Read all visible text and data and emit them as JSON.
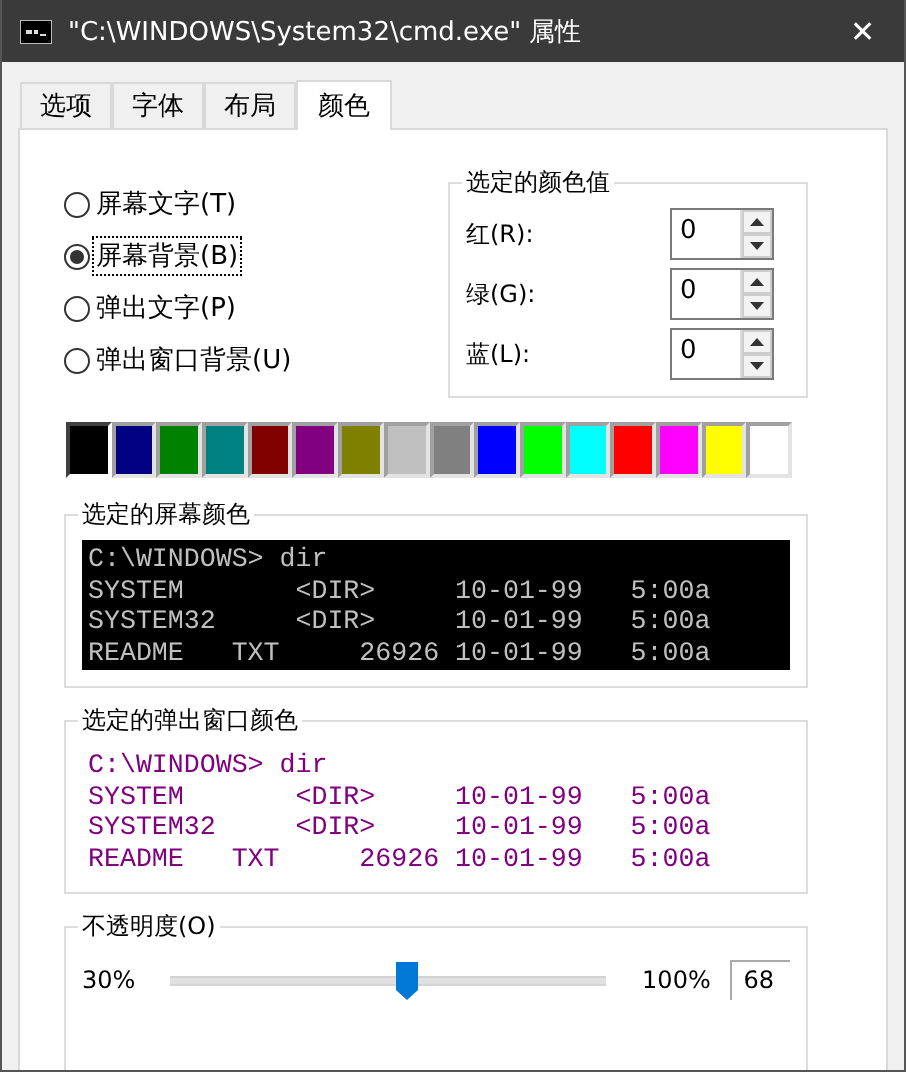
{
  "window": {
    "title": "\"C:\\WINDOWS\\System32\\cmd.exe\" 属性",
    "close": "✕"
  },
  "tabs": [
    {
      "label": "选项",
      "selected": false
    },
    {
      "label": "字体",
      "selected": false
    },
    {
      "label": "布局",
      "selected": false
    },
    {
      "label": "颜色",
      "selected": true
    }
  ],
  "targets": [
    {
      "label": "屏幕文字(T)",
      "selected": false
    },
    {
      "label": "屏幕背景(B)",
      "selected": true
    },
    {
      "label": "弹出文字(P)",
      "selected": false
    },
    {
      "label": "弹出窗口背景(U)",
      "selected": false
    }
  ],
  "color_values": {
    "title": "选定的颜色值",
    "fields": [
      {
        "label": "红(R):",
        "value": "0"
      },
      {
        "label": "绿(G):",
        "value": "0"
      },
      {
        "label": "蓝(L):",
        "value": "0"
      }
    ]
  },
  "palette": [
    {
      "color": "#000000",
      "selected": true
    },
    {
      "color": "#000080",
      "selected": false
    },
    {
      "color": "#008000",
      "selected": false
    },
    {
      "color": "#008080",
      "selected": false
    },
    {
      "color": "#800000",
      "selected": false
    },
    {
      "color": "#800080",
      "selected": false
    },
    {
      "color": "#808000",
      "selected": false
    },
    {
      "color": "#c0c0c0",
      "selected": false
    },
    {
      "color": "#808080",
      "selected": false
    },
    {
      "color": "#0000ff",
      "selected": false
    },
    {
      "color": "#00ff00",
      "selected": false
    },
    {
      "color": "#00ffff",
      "selected": false
    },
    {
      "color": "#ff0000",
      "selected": false
    },
    {
      "color": "#ff00ff",
      "selected": false
    },
    {
      "color": "#ffff00",
      "selected": false
    },
    {
      "color": "#ffffff",
      "selected": false
    }
  ],
  "screen_preview": {
    "title": "选定的屏幕颜色",
    "lines": [
      "C:\\WINDOWS> dir",
      "SYSTEM       <DIR>     10-01-99   5:00a",
      "SYSTEM32     <DIR>     10-01-99   5:00a",
      "README   TXT     26926 10-01-99   5:00a"
    ]
  },
  "popup_preview": {
    "title": "选定的弹出窗口颜色",
    "lines": [
      "C:\\WINDOWS> dir",
      "SYSTEM       <DIR>     10-01-99   5:00a",
      "SYSTEM32     <DIR>     10-01-99   5:00a",
      "README   TXT     26926 10-01-99   5:00a"
    ]
  },
  "opacity": {
    "title": "不透明度(O)",
    "min_label": "30%",
    "max_label": "100%",
    "level": 0.54,
    "value": "68"
  }
}
